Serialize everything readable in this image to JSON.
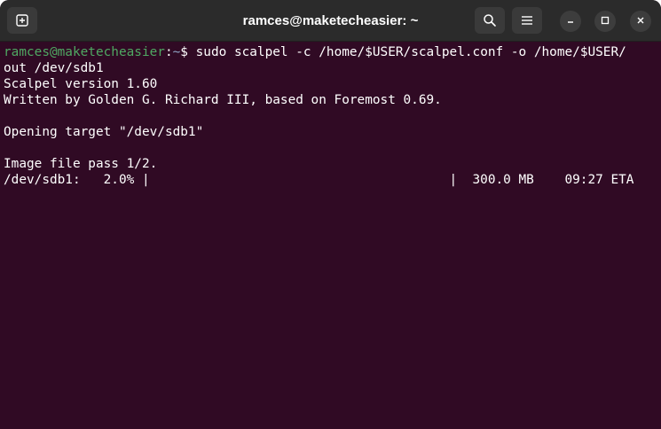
{
  "window": {
    "title": "ramces@maketecheasier: ~",
    "icons": {
      "new_tab": "new-tab-icon",
      "search": "search-icon",
      "menu": "hamburger-menu-icon",
      "minimize": "minimize-icon",
      "maximize": "maximize-icon",
      "close": "close-icon"
    }
  },
  "colors": {
    "terminal_bg": "#300a24",
    "titlebar_bg": "#2b2b2b",
    "prompt_user": "#4fa862",
    "prompt_path": "#8fa7c6",
    "text": "#ffffff"
  },
  "terminal": {
    "prompt": {
      "user_host": "ramces@maketecheasier",
      "separator": ":",
      "path": "~",
      "symbol": "$ ",
      "command_line1": "sudo scalpel -c /home/$USER/scalpel.conf -o /home/$USER/",
      "command_line2": "out /dev/sdb1"
    },
    "lines": [
      "Scalpel version 1.60",
      "Written by Golden G. Richard III, based on Foremost 0.69.",
      "",
      "Opening target \"/dev/sdb1\"",
      "",
      "Image file pass 1/2.",
      "/dev/sdb1:   2.0% |                                       |  300.0 MB    09:27 ETA"
    ]
  }
}
